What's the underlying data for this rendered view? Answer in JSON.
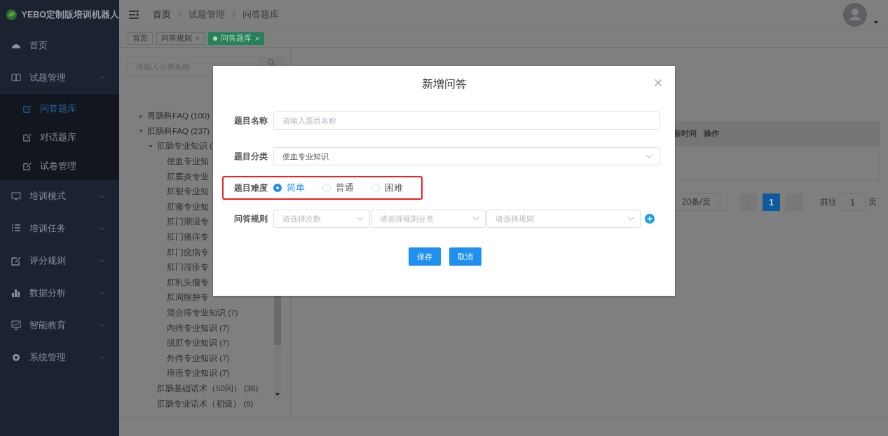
{
  "app": {
    "title": "YEBO定制版培训机器人"
  },
  "sidebar": {
    "items": [
      {
        "label": "首页"
      },
      {
        "label": "试题管理",
        "expanded": true,
        "children": [
          {
            "label": "问答题库",
            "selected": true
          },
          {
            "label": "对话题库",
            "selected": false
          },
          {
            "label": "试卷管理",
            "selected": false
          }
        ]
      },
      {
        "label": "培训模式",
        "expanded": false
      },
      {
        "label": "培训任务",
        "expanded": false
      },
      {
        "label": "评分规则",
        "expanded": false
      },
      {
        "label": "数据分析",
        "expanded": false
      },
      {
        "label": "智能教育",
        "expanded": false
      },
      {
        "label": "系统管理",
        "expanded": false
      }
    ]
  },
  "breadcrumb": [
    "首页",
    "试题管理",
    "问答题库"
  ],
  "tabs": [
    {
      "label": "首页",
      "selected": false,
      "closable": false
    },
    {
      "label": "问答规则",
      "selected": false,
      "closable": true
    },
    {
      "label": "问答题库",
      "selected": true,
      "closable": true
    }
  ],
  "category_panel": {
    "search": {
      "placeholder": "请输入分类名称"
    },
    "tree": [
      {
        "label": "胃肠科FAQ (100)",
        "expanded": false
      },
      {
        "label": "肛肠科FAQ (237)",
        "expanded": true,
        "children": [
          {
            "label": "肛肠专业知识 (",
            "expanded": true,
            "children": [
              {
                "label": "便血专业知"
              },
              {
                "label": "肛窦炎专业"
              },
              {
                "label": "肛裂专业知"
              },
              {
                "label": "肛瘘专业知"
              },
              {
                "label": "肛门潮湿专"
              },
              {
                "label": "肛门瘙痒专"
              },
              {
                "label": "肛门疣病专"
              },
              {
                "label": "肛门湿疹专"
              },
              {
                "label": "肛乳头瘤专"
              },
              {
                "label": "肛周脓肿专"
              },
              {
                "label": "混合痔专业知识 (7)"
              },
              {
                "label": "内痔专业知识 (7)"
              },
              {
                "label": "脱肛专业知识 (7)"
              },
              {
                "label": "外痔专业知识 (7)"
              },
              {
                "label": "痔疮专业知识 (7)"
              }
            ]
          },
          {
            "label": "肛肠基础话术（50问） (36)"
          },
          {
            "label": "肛肠专业话术（初级） (9)"
          }
        ]
      }
    ]
  },
  "table": {
    "columns": [
      "新时间",
      "操作"
    ]
  },
  "pagination": {
    "page_size": "20条/页",
    "pages": [
      {
        "label": "1",
        "selected": true
      }
    ],
    "goto_label": "前往",
    "goto_value": "1",
    "goto_suffix": "页"
  },
  "dialog": {
    "title": "新增问答",
    "fields": [
      {
        "kind": "input",
        "label": "题目名称",
        "placeholder": "请输入题目名称",
        "highlighted": false
      },
      {
        "kind": "select",
        "label": "题目分类",
        "value": "便血专业知识",
        "highlighted": false
      },
      {
        "kind": "radio",
        "label": "题目难度",
        "highlighted": true,
        "options": [
          {
            "label": "简单",
            "selected": true
          },
          {
            "label": "普通",
            "selected": false
          },
          {
            "label": "困难",
            "selected": false
          }
        ]
      },
      {
        "kind": "rules",
        "label": "问答规则",
        "highlighted": false,
        "selects": [
          {
            "placeholder": "请选择次数"
          },
          {
            "placeholder": "请选择规则分类"
          },
          {
            "placeholder": "请选择规则"
          }
        ]
      }
    ],
    "buttons": [
      "保存",
      "取消"
    ]
  }
}
